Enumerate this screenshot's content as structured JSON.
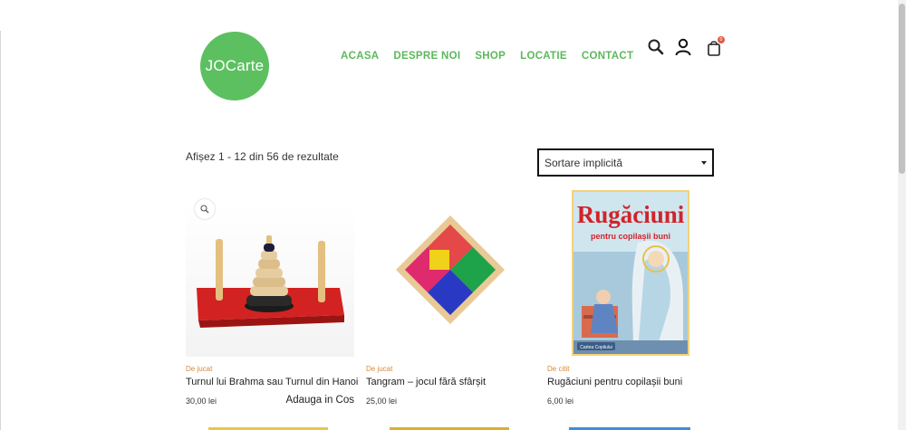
{
  "header": {
    "logo_text": "JOCarte",
    "nav": [
      "ACASA",
      "DESPRE NOI",
      "SHOP",
      "LOCATIE",
      "CONTACT"
    ],
    "cart_count": "0"
  },
  "shop": {
    "result_count": "Afișez 1 - 12 din 56 de rezultate",
    "sort_selected": "Sortare implicită"
  },
  "products": [
    {
      "category": "De jucat",
      "title": "Turnul lui Brahma sau Turnul din Hanoi",
      "price": "30,00 lei",
      "add_to_cart": "Adauga in Cos"
    },
    {
      "category": "De jucat",
      "title": "Tangram – jocul fără sfârșit",
      "price": "25,00 lei",
      "add_to_cart": ""
    },
    {
      "category": "De citit",
      "title": "Rugăciuni pentru copilașii buni",
      "price": "6,00 lei",
      "add_to_cart": ""
    }
  ],
  "book_cover": {
    "title": "Rugăciuni",
    "subtitle": "pentru copilașii buni",
    "publisher": "Cartea Copilului"
  },
  "colors": {
    "brand_green": "#5cc060",
    "nav_green": "#5cb85c",
    "category_orange": "#d8893b",
    "cart_badge": "#e05a47"
  },
  "icons": [
    "search-icon",
    "user-icon",
    "shopping-bag-icon",
    "zoom-icon",
    "caret-down-icon"
  ]
}
